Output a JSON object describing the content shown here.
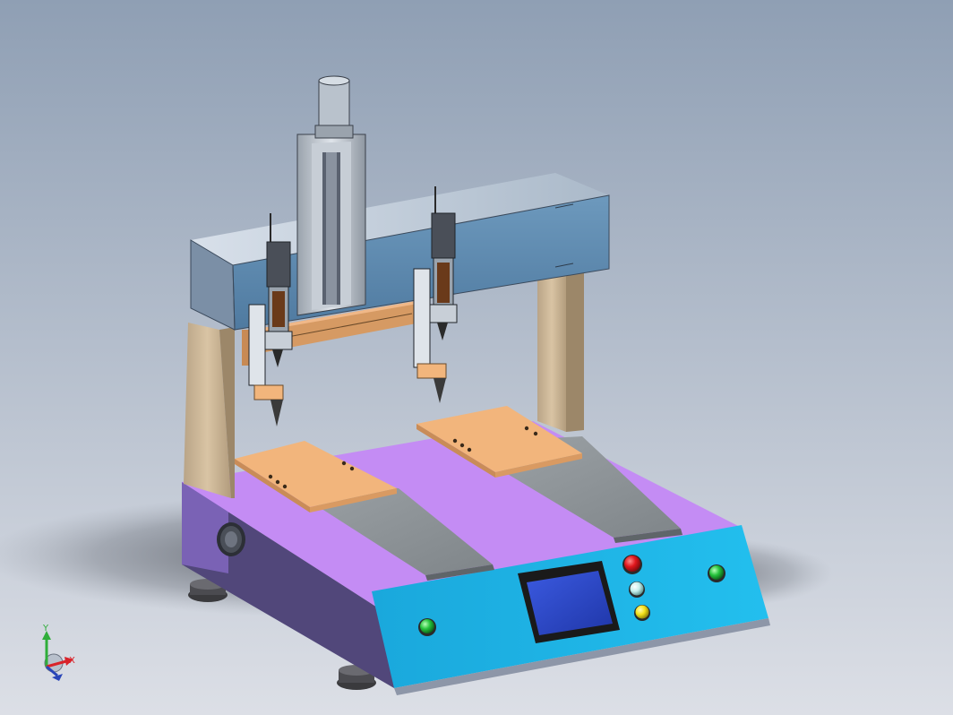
{
  "viewport": {
    "background_top": "#8f9fb4",
    "background_bottom": "#dcdfe6"
  },
  "triad": {
    "x_label": "X",
    "y_label": "Y",
    "x_color": "#d9232a",
    "y_color": "#2fae3a",
    "z_color": "#2a46b8"
  },
  "model": {
    "base_front_color": "#1bb4e6",
    "base_top_color": "#c48cf4",
    "base_side_color": "#51477a",
    "gantry_beam_color": "#5c8ab0",
    "gantry_post_color": "#c9b394",
    "fixture_plate_color": "#f2b57c",
    "rail_color": "#8f9599",
    "screen_color": "#2a47c9",
    "buttons": [
      {
        "name": "red-button",
        "color": "#e0161c"
      },
      {
        "name": "cyan-button",
        "color": "#c5f0ec"
      },
      {
        "name": "yellow-button",
        "color": "#f3e21a"
      },
      {
        "name": "green-button-left",
        "color": "#24c23b"
      },
      {
        "name": "green-button-right",
        "color": "#24c23b"
      }
    ]
  }
}
